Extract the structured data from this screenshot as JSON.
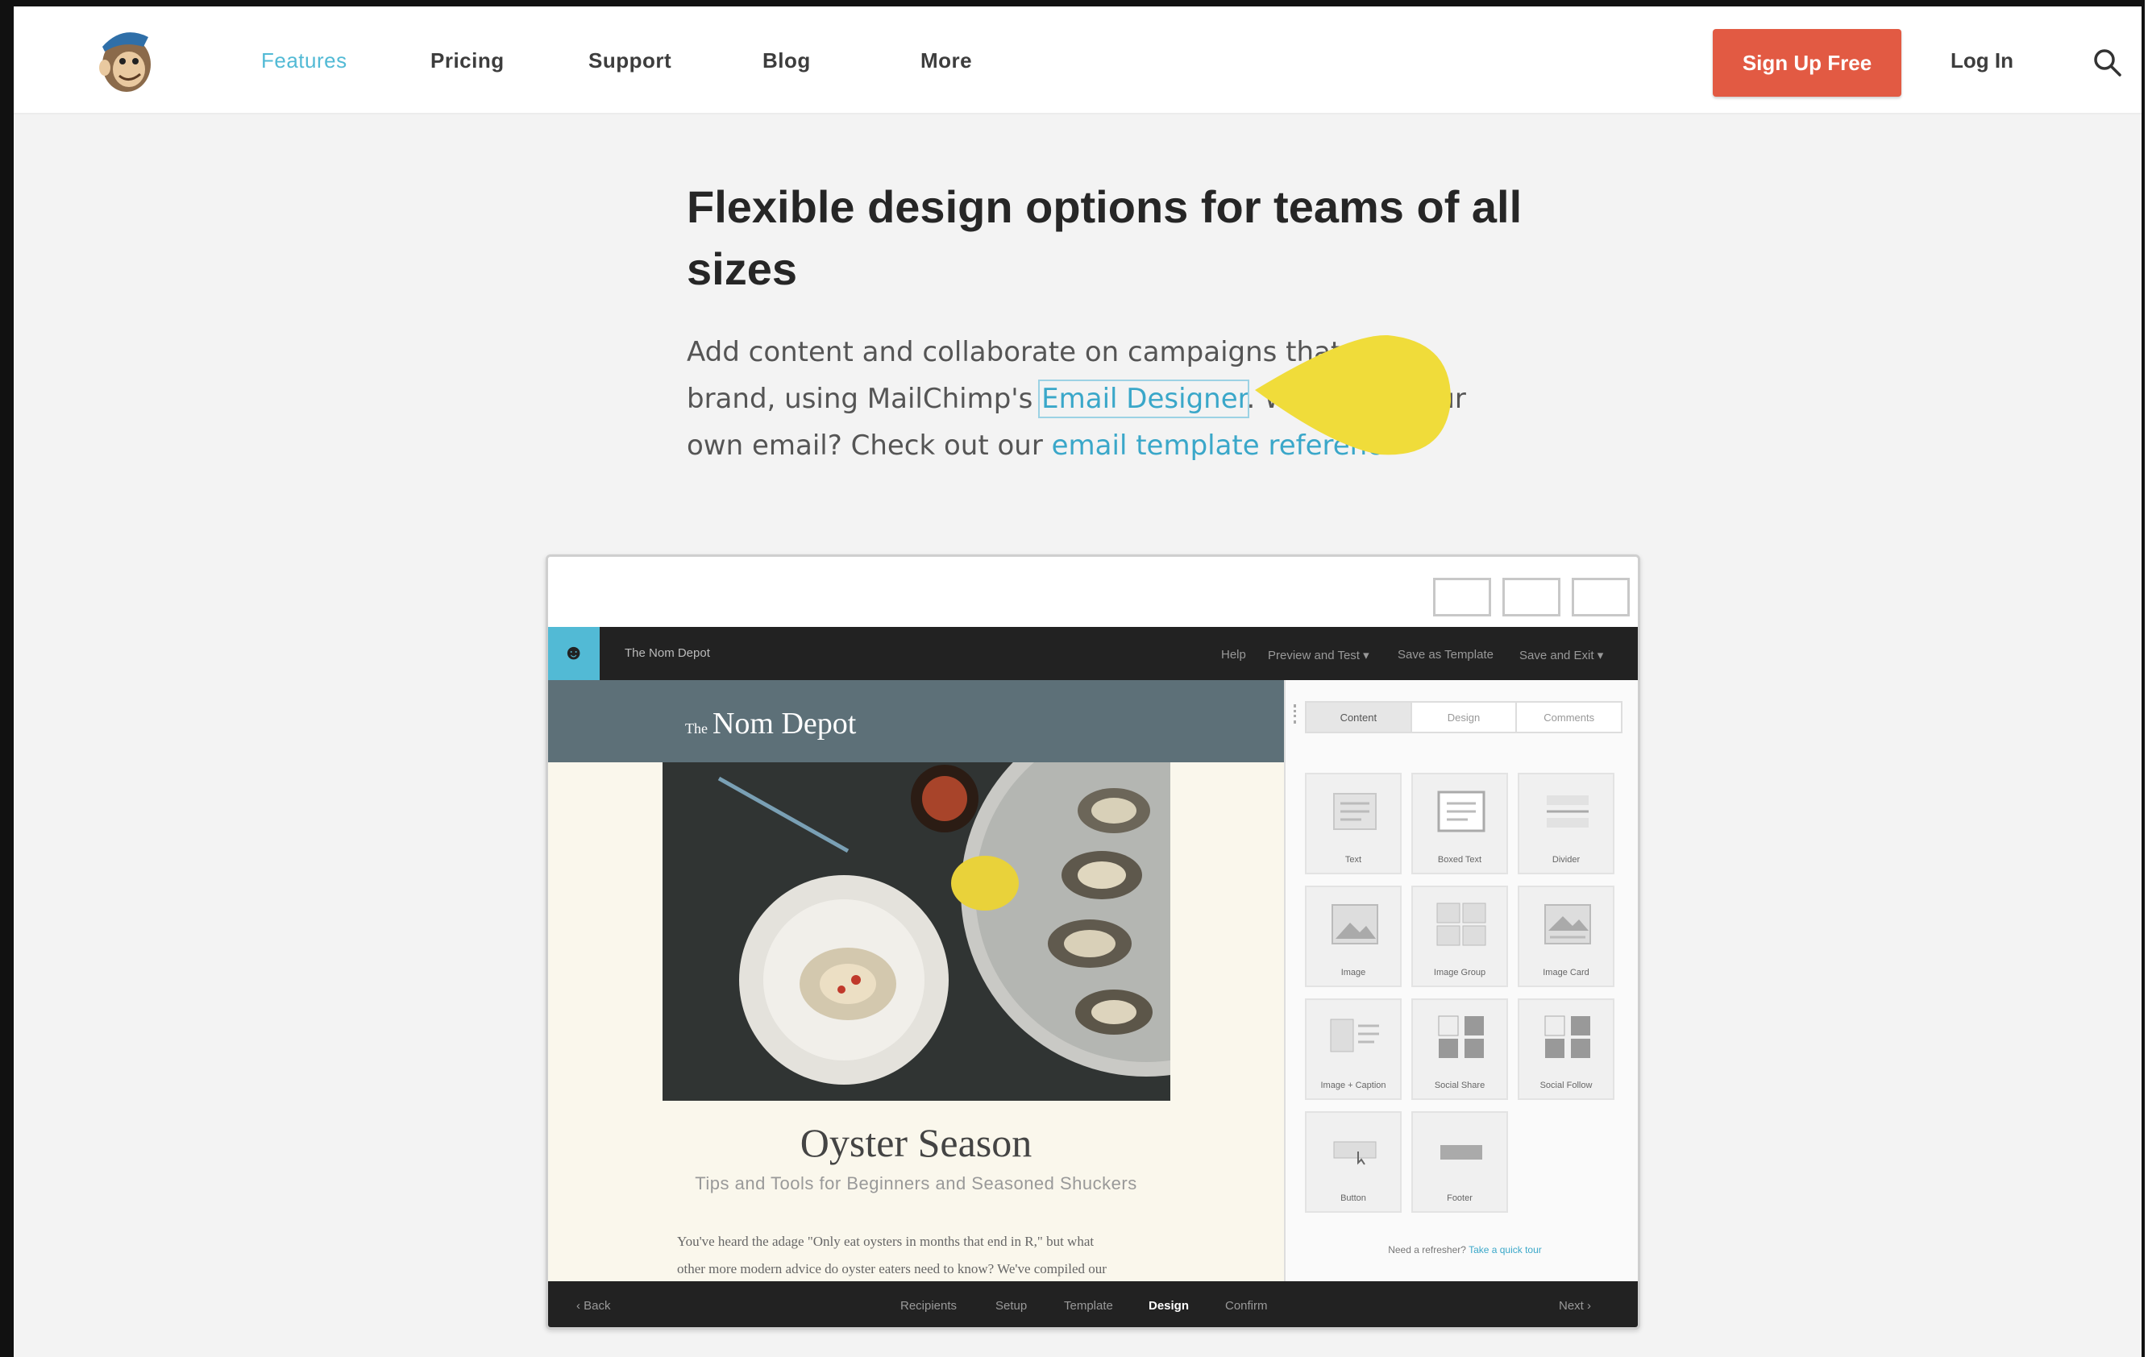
{
  "nav": {
    "items": [
      {
        "label": "Features",
        "active": true
      },
      {
        "label": "Pricing",
        "active": false
      },
      {
        "label": "Support",
        "active": false
      },
      {
        "label": "Blog",
        "active": false
      },
      {
        "label": "More",
        "active": false
      }
    ],
    "signup_label": "Sign Up Free",
    "login_label": "Log In",
    "search_icon": "search-icon",
    "brand_icon": "freddie-monkey-logo"
  },
  "hero": {
    "heading": "Flexible design options for teams of all sizes",
    "para_part1": "Add content and collaborate on campaigns that",
    "para_part2": "brand, using MailChimp's",
    "link_email_designer": "Email Designer",
    "para_part3": ". W",
    "para_part4": "our",
    "para_part5": "own email? Check out our",
    "link_template_reference": "email template referenc",
    "para_part6": "."
  },
  "app": {
    "topbar_title": "The Nom Depot",
    "topbar_items": [
      "Help",
      "Preview and Test ▾",
      "Save as Template",
      "Save and Exit ▾"
    ],
    "email": {
      "brand_prefix": "The",
      "brand": "Nom Depot",
      "title": "Oyster Season",
      "subtitle": "Tips and Tools for Beginners and Seasoned Shuckers",
      "body_line1": "You've heard the adage \"Only eat oysters in months that end in R,\" but what",
      "body_line2": "other more modern advice do oyster eaters need to know? We've compiled our"
    },
    "side": {
      "tabs": [
        "Content",
        "Design",
        "Comments"
      ],
      "active_tab": "Content",
      "blocks": [
        "Text",
        "Boxed Text",
        "Divider",
        "Image",
        "Image Group",
        "Image Card",
        "Image + Caption",
        "Social Share",
        "Social Follow",
        "Button",
        "Footer"
      ],
      "help_text": "Need a refresher?",
      "help_link": "Take a quick tour"
    },
    "footer": {
      "back": "‹  Back",
      "steps": [
        "Recipients",
        "Setup",
        "Template",
        "Design",
        "Confirm"
      ],
      "current_step": "Design",
      "next": "Next  ›"
    }
  },
  "colors": {
    "accent": "#52bad5",
    "signup": "#e25a43",
    "link": "#3aa7c9",
    "cursor": "#f0dc3a"
  }
}
